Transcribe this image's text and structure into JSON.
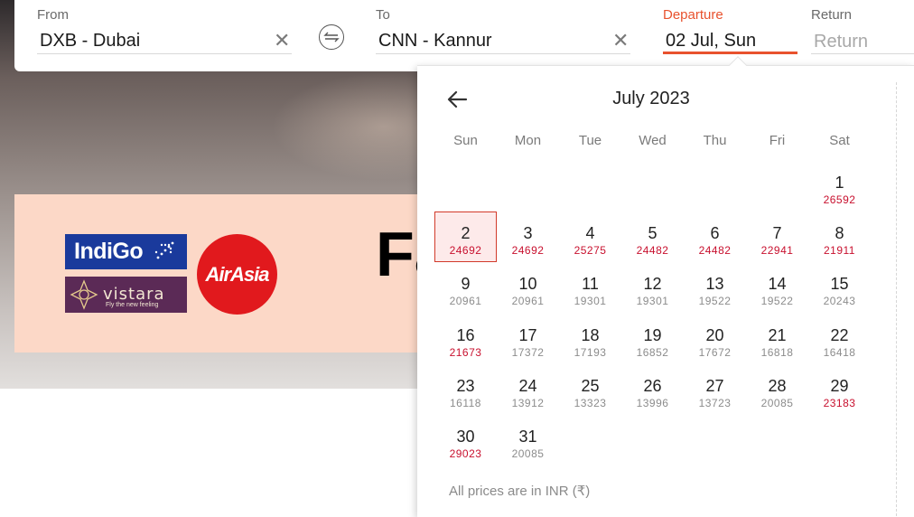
{
  "search": {
    "from": {
      "label": "From",
      "value": "DXB - Dubai"
    },
    "to": {
      "label": "To",
      "value": "CNN - Kannur"
    },
    "departure": {
      "label": "Departure",
      "value": "02 Jul, Sun"
    },
    "return": {
      "label": "Return",
      "placeholder": "Return"
    },
    "clear_glyph": "✕"
  },
  "banner": {
    "heading": "Fa",
    "indigo_text": "IndiGo",
    "vistara_text": "vistara",
    "vistara_tagline": "Fly the new feeling",
    "airasia_text": "AirAsia"
  },
  "colors": {
    "accent": "#e8522e",
    "price_high": "#c8102e",
    "price_normal": "#8c8c8c"
  },
  "calendar": {
    "title": "July 2023",
    "weekdays": [
      "Sun",
      "Mon",
      "Tue",
      "Wed",
      "Thu",
      "Fri",
      "Sat"
    ],
    "selected_day": 2,
    "days": [
      {
        "day": "1",
        "price": "26592",
        "high": true
      },
      {
        "day": "2",
        "price": "24692",
        "high": true
      },
      {
        "day": "3",
        "price": "24692",
        "high": true
      },
      {
        "day": "4",
        "price": "25275",
        "high": true
      },
      {
        "day": "5",
        "price": "24482",
        "high": true
      },
      {
        "day": "6",
        "price": "24482",
        "high": true
      },
      {
        "day": "7",
        "price": "22941",
        "high": true
      },
      {
        "day": "8",
        "price": "21911",
        "high": true
      },
      {
        "day": "9",
        "price": "20961",
        "high": false
      },
      {
        "day": "10",
        "price": "20961",
        "high": false
      },
      {
        "day": "11",
        "price": "19301",
        "high": false
      },
      {
        "day": "12",
        "price": "19301",
        "high": false
      },
      {
        "day": "13",
        "price": "19522",
        "high": false
      },
      {
        "day": "14",
        "price": "19522",
        "high": false
      },
      {
        "day": "15",
        "price": "20243",
        "high": false
      },
      {
        "day": "16",
        "price": "21673",
        "high": true
      },
      {
        "day": "17",
        "price": "17372",
        "high": false
      },
      {
        "day": "18",
        "price": "17193",
        "high": false
      },
      {
        "day": "19",
        "price": "16852",
        "high": false
      },
      {
        "day": "20",
        "price": "17672",
        "high": false
      },
      {
        "day": "21",
        "price": "16818",
        "high": false
      },
      {
        "day": "22",
        "price": "16418",
        "high": false
      },
      {
        "day": "23",
        "price": "16118",
        "high": false
      },
      {
        "day": "24",
        "price": "13912",
        "high": false
      },
      {
        "day": "25",
        "price": "13323",
        "high": false
      },
      {
        "day": "26",
        "price": "13996",
        "high": false
      },
      {
        "day": "27",
        "price": "13723",
        "high": false
      },
      {
        "day": "28",
        "price": "20085",
        "high": false
      },
      {
        "day": "29",
        "price": "23183",
        "high": true
      },
      {
        "day": "30",
        "price": "29023",
        "high": true
      },
      {
        "day": "31",
        "price": "20085",
        "high": false
      }
    ],
    "footer": "All prices are in INR (₹)"
  }
}
